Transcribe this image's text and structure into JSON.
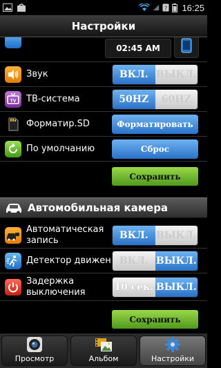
{
  "status_bar": {
    "time": "16:25"
  },
  "title": "Настройки",
  "top_partial_row": {
    "time_value": "02:45 AM"
  },
  "settings": {
    "sound": {
      "label": "Звук",
      "on": "ВКЛ.",
      "off": "ВЫКЛ.",
      "selected": "on"
    },
    "tv_system": {
      "label": "ТВ-система",
      "opt1": "50HZ",
      "opt2": "60HZ",
      "selected": "opt1"
    },
    "format_sd": {
      "label": "Форматир.SD",
      "button": "Форматировать"
    },
    "default": {
      "label": "По умолчанию",
      "button": "Сброс"
    },
    "save1": "Сохранить"
  },
  "car_camera": {
    "header": "Автомобильная камера",
    "auto_record": {
      "label_line1": "Автоматическая",
      "label_line2": "запись",
      "on": "ВКЛ.",
      "off": "ВЫКЛ.",
      "selected": "on"
    },
    "motion_detector": {
      "label": "Детектор движения",
      "on": "ВКЛ.",
      "off": "ВЫКЛ.",
      "selected": "off"
    },
    "shutdown_delay": {
      "label_line1": "Задержка",
      "label_line2": "выключения",
      "opt1": "10 сек.",
      "opt2": "ВЫКЛ.",
      "selected": "opt2"
    },
    "save2": "Сохранить"
  },
  "bottom_tabs": [
    {
      "label": "Просмотр",
      "icon": "camera-lens-icon"
    },
    {
      "label": "Альбом",
      "icon": "film-photo-icon"
    },
    {
      "label": "Настройки",
      "icon": "gear-icon",
      "active": true
    }
  ]
}
